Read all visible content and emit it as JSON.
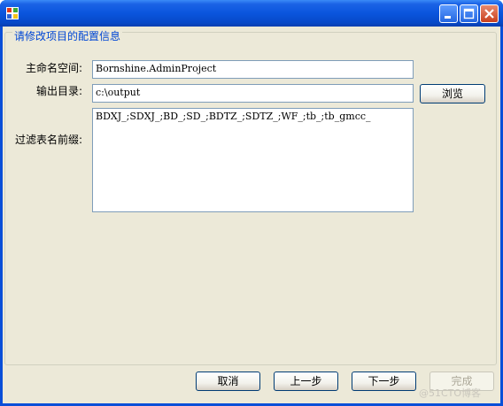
{
  "window": {
    "app_icon": "windows-form-icon",
    "controls": {
      "minimize": "minimize-icon",
      "maximize": "maximize-icon",
      "close": "close-icon"
    }
  },
  "group": {
    "title": "请修改项目的配置信息"
  },
  "form": {
    "namespace": {
      "label": "主命名空间:",
      "value": "Bornshine.AdminProject"
    },
    "output_dir": {
      "label": "输出目录:",
      "value": "c:\\output",
      "browse_label": "浏览"
    },
    "table_prefix": {
      "label": "过滤表名前缀:",
      "value": "BDXJ_;SDXJ_;BD_;SD_;BDTZ_;SDTZ_;WF_;tb_;tb_gmcc_"
    }
  },
  "footer": {
    "cancel_label": "取消",
    "prev_label": "上一步",
    "next_label": "下一步",
    "finish_label": "完成",
    "finish_enabled": false
  },
  "watermark": "@51CTO博客",
  "colors": {
    "titlebar": "#0a55dd",
    "client_bg": "#ece9d8",
    "group_title": "#0046d5",
    "close_button": "#c9401d"
  }
}
